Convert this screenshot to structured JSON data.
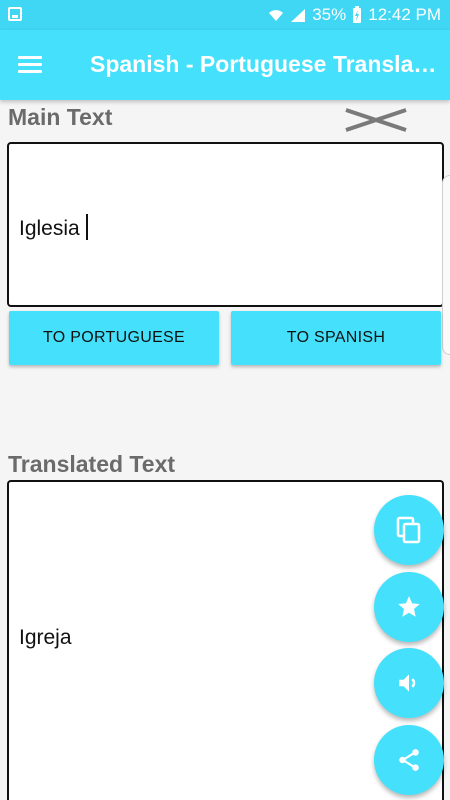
{
  "status_bar": {
    "battery": "35%",
    "time": "12:42 PM"
  },
  "app_bar": {
    "title": "Spanish - Portuguese Translator",
    "menu_icon": "hamburger-menu-icon"
  },
  "main_section": {
    "label": "Main Text",
    "input_value": "Iglesia",
    "clear_icon": "clear-x-icon"
  },
  "buttons": {
    "to_portuguese": "TO PORTUGUESE",
    "to_spanish": "TO SPANISH"
  },
  "translated_section": {
    "label": "Translated Text",
    "output_value": "Igreja"
  },
  "fabs": [
    {
      "icon": "copy-icon"
    },
    {
      "icon": "star-icon"
    },
    {
      "icon": "speaker-icon"
    },
    {
      "icon": "share-icon"
    }
  ],
  "colors": {
    "status_bar": "#3fd7f4",
    "accent": "#45e0fb",
    "label_gray": "#6b6b6b"
  }
}
